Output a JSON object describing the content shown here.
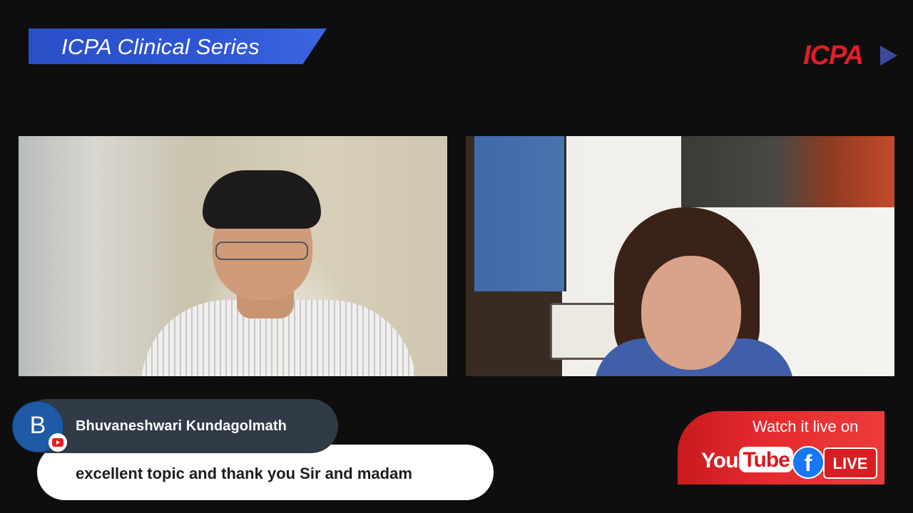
{
  "header": {
    "series_title": "ICPA Clinical Series",
    "logo_text": "ICPA"
  },
  "chat": {
    "author_initial": "B",
    "author_name": "Bhuvaneshwari Kundagolmath",
    "message": "excellent topic and thank you Sir and madam",
    "platform_icon": "youtube-icon"
  },
  "promo": {
    "watch_text": "Watch it live on",
    "youtube_you": "You",
    "youtube_tube": "Tube",
    "facebook_letter": "f",
    "live_label": "LIVE"
  },
  "colors": {
    "banner_blue": "#2e57d4",
    "icpa_red": "#e01e26",
    "promo_red": "#e42a2e",
    "facebook_blue": "#1877f2",
    "chat_pill": "#313a47"
  }
}
